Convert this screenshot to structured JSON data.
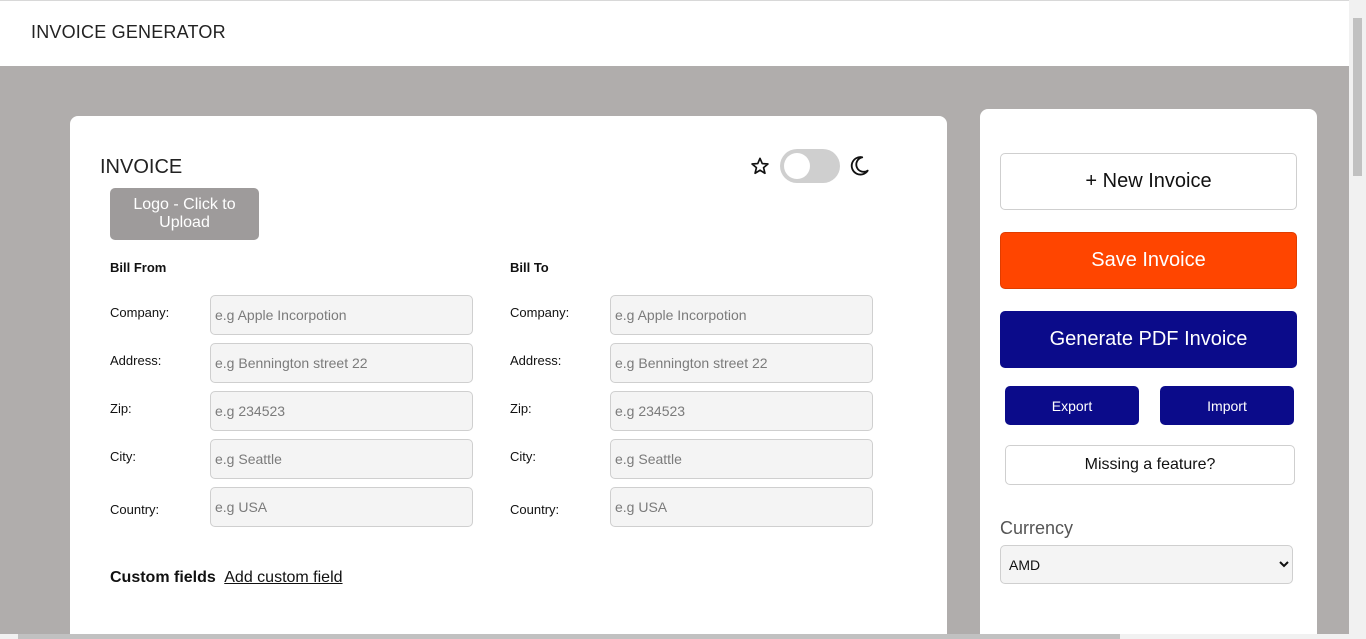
{
  "header": {
    "title": "INVOICE GENERATOR"
  },
  "invoice": {
    "heading": "INVOICE",
    "logo_button": "Logo - Click to Upload",
    "theme": {
      "left_icon": "star-icon",
      "right_icon": "moon-icon",
      "dark_mode": false
    },
    "bill_from": {
      "title": "Bill From",
      "fields": [
        {
          "label": "Company:",
          "placeholder": "e.g Apple Incorpotion",
          "value": ""
        },
        {
          "label": "Address:",
          "placeholder": "e.g Bennington street 22",
          "value": ""
        },
        {
          "label": "Zip:",
          "placeholder": "e.g 234523",
          "value": ""
        },
        {
          "label": "City:",
          "placeholder": "e.g Seattle",
          "value": ""
        },
        {
          "label": "Country:",
          "placeholder": "e.g USA",
          "value": ""
        }
      ]
    },
    "bill_to": {
      "title": "Bill To",
      "fields": [
        {
          "label": "Company:",
          "placeholder": "e.g Apple Incorpotion",
          "value": ""
        },
        {
          "label": "Address:",
          "placeholder": "e.g Bennington street 22",
          "value": ""
        },
        {
          "label": "Zip:",
          "placeholder": "e.g 234523",
          "value": ""
        },
        {
          "label": "City:",
          "placeholder": "e.g Seattle",
          "value": ""
        },
        {
          "label": "Country:",
          "placeholder": "e.g USA",
          "value": ""
        }
      ]
    },
    "custom_fields": {
      "label": "Custom fields",
      "add_link": "Add custom field"
    }
  },
  "sidebar": {
    "new_invoice": "+ New Invoice",
    "save_invoice": "Save Invoice",
    "generate_pdf": "Generate PDF Invoice",
    "export": "Export",
    "import": "Import",
    "missing_feature": "Missing a feature?",
    "currency": {
      "label": "Currency",
      "selected": "AMD"
    }
  },
  "colors": {
    "page_background": "#b0adac",
    "save_button": "#ff4500",
    "primary_navy": "#0b0b8a",
    "logo_button": "#9e9b9b",
    "toggle_track": "#cfcfcf"
  }
}
